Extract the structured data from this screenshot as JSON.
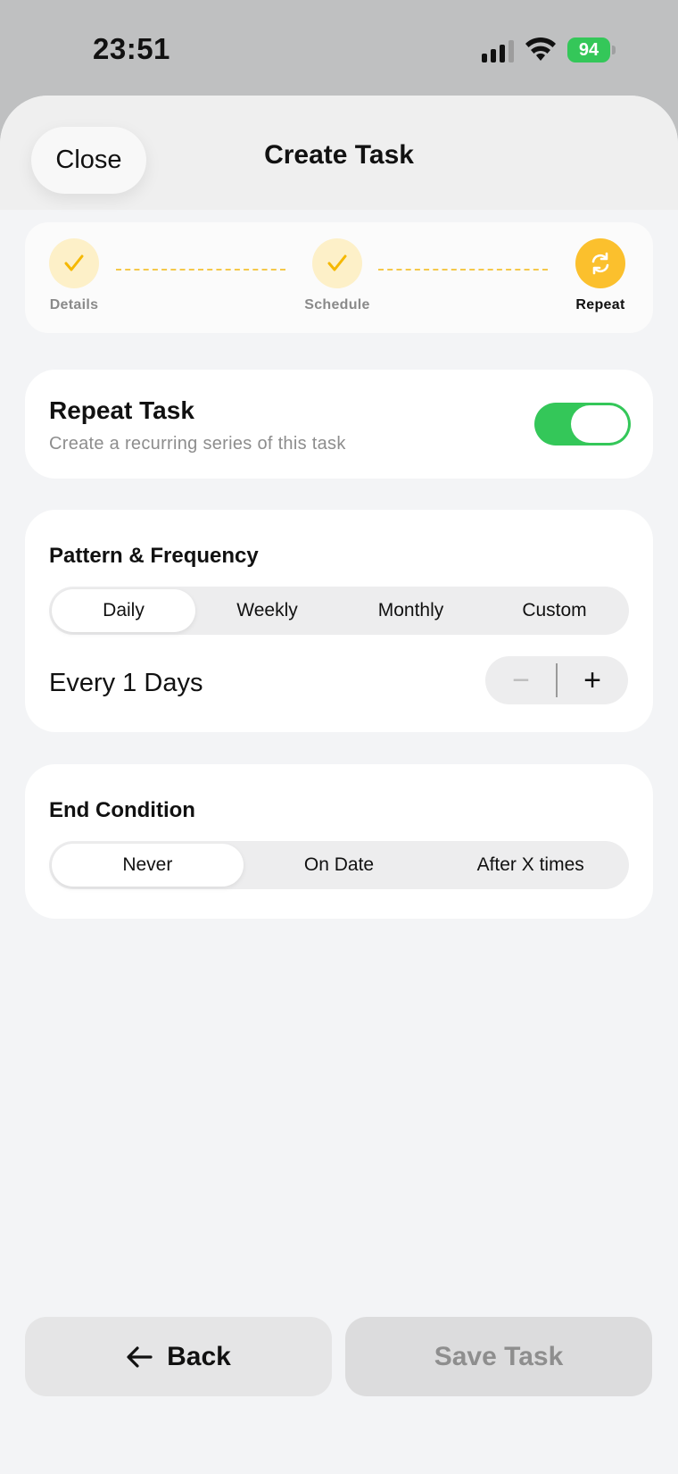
{
  "status_bar": {
    "time": "23:51",
    "battery": "94"
  },
  "header": {
    "close_label": "Close",
    "title": "Create Task"
  },
  "stepper": {
    "steps": [
      {
        "label": "Details",
        "state": "done"
      },
      {
        "label": "Schedule",
        "state": "done"
      },
      {
        "label": "Repeat",
        "state": "active"
      }
    ]
  },
  "repeat": {
    "title": "Repeat Task",
    "subtitle": "Create a recurring series of this task",
    "enabled": true
  },
  "frequency": {
    "heading": "Pattern & Frequency",
    "options": [
      "Daily",
      "Weekly",
      "Monthly",
      "Custom"
    ],
    "selected": "Daily",
    "every_text": "Every 1 Days",
    "minus": "−",
    "plus": "+"
  },
  "end_condition": {
    "heading": "End Condition",
    "options": [
      "Never",
      "On Date",
      "After X times"
    ],
    "selected": "Never"
  },
  "footer": {
    "back_label": "Back",
    "save_label": "Save Task"
  },
  "colors": {
    "accent": "#fbc02d",
    "toggle_on": "#34c759",
    "sheet_bg": "#f3f4f6"
  }
}
